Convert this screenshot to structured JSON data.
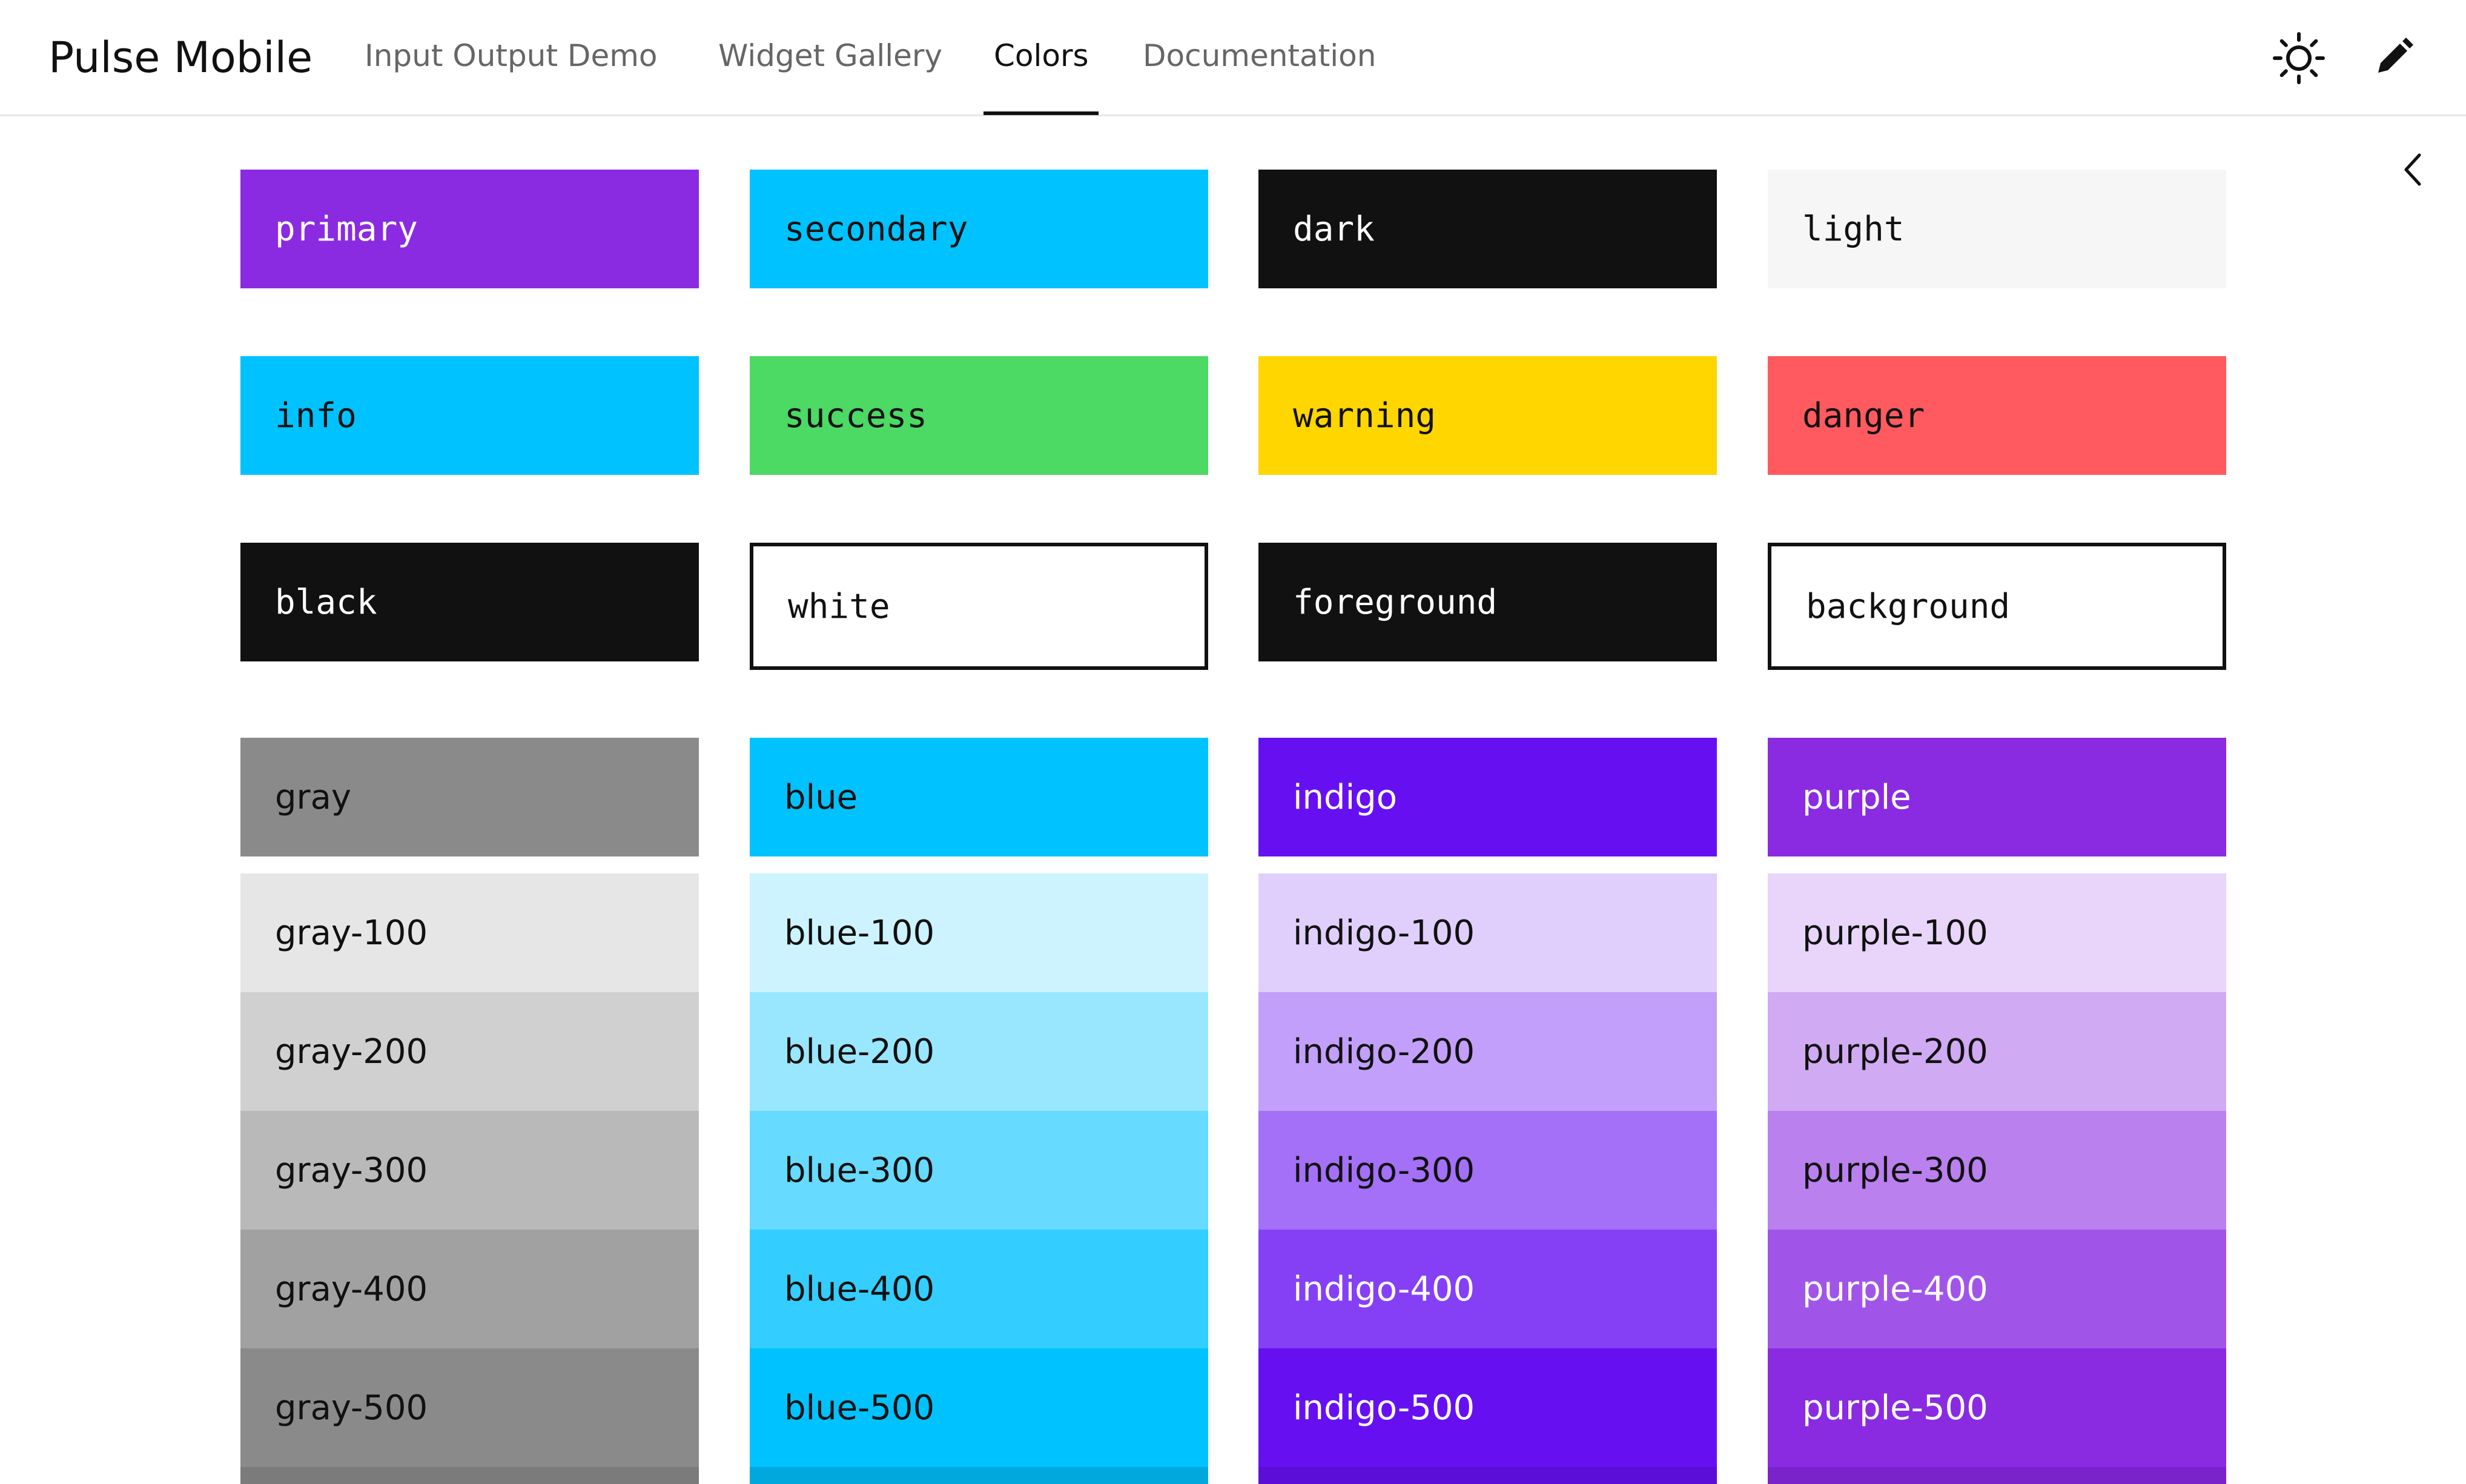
{
  "app": {
    "title": "Pulse Mobile"
  },
  "nav": {
    "items": [
      {
        "label": "Input Output Demo"
      },
      {
        "label": "Widget Gallery"
      },
      {
        "label": "Colors"
      },
      {
        "label": "Documentation"
      }
    ],
    "active_index": 2
  },
  "toolbar": {
    "icons": [
      "sun-icon",
      "pencil-icon"
    ],
    "collapse_icon": "chevron-left-icon"
  },
  "named_colors": [
    {
      "name": "primary",
      "bg": "#8A2BE2",
      "fg": "#FFFFFF"
    },
    {
      "name": "secondary",
      "bg": "#00C2FF",
      "fg": "#111111"
    },
    {
      "name": "dark",
      "bg": "#111111",
      "fg": "#FFFFFF"
    },
    {
      "name": "light",
      "bg": "#F6F6F6",
      "fg": "#111111"
    },
    {
      "name": "info",
      "bg": "#00C2FF",
      "fg": "#111111"
    },
    {
      "name": "success",
      "bg": "#4CD964",
      "fg": "#111111"
    },
    {
      "name": "warning",
      "bg": "#FFD600",
      "fg": "#111111"
    },
    {
      "name": "danger",
      "bg": "#FF5A5F",
      "fg": "#111111"
    },
    {
      "name": "black",
      "bg": "#111111",
      "fg": "#FFFFFF"
    },
    {
      "name": "white",
      "bg": "#FFFFFF",
      "fg": "#111111",
      "outlined": true
    },
    {
      "name": "foreground",
      "bg": "#111111",
      "fg": "#FFFFFF"
    },
    {
      "name": "background",
      "bg": "#FFFFFF",
      "fg": "#111111",
      "outlined": true
    }
  ],
  "palettes": [
    {
      "base": {
        "name": "gray",
        "bg": "#8A8A8A",
        "fg": "#111111"
      },
      "shades": [
        {
          "name": "gray-100",
          "bg": "#E6E6E6",
          "fg": "#111111"
        },
        {
          "name": "gray-200",
          "bg": "#D0D0D0",
          "fg": "#111111"
        },
        {
          "name": "gray-300",
          "bg": "#B9B9B9",
          "fg": "#111111"
        },
        {
          "name": "gray-400",
          "bg": "#A1A1A1",
          "fg": "#111111"
        },
        {
          "name": "gray-500",
          "bg": "#8A8A8A",
          "fg": "#111111"
        }
      ]
    },
    {
      "base": {
        "name": "blue",
        "bg": "#00C2FF",
        "fg": "#111111"
      },
      "shades": [
        {
          "name": "blue-100",
          "bg": "#CCF3FF",
          "fg": "#111111"
        },
        {
          "name": "blue-200",
          "bg": "#99E7FF",
          "fg": "#111111"
        },
        {
          "name": "blue-300",
          "bg": "#66DAFF",
          "fg": "#111111"
        },
        {
          "name": "blue-400",
          "bg": "#33CEFF",
          "fg": "#111111"
        },
        {
          "name": "blue-500",
          "bg": "#00C2FF",
          "fg": "#111111"
        }
      ]
    },
    {
      "base": {
        "name": "indigo",
        "bg": "#6610F2",
        "fg": "#FFFFFF"
      },
      "shades": [
        {
          "name": "indigo-100",
          "bg": "#E0CFFC",
          "fg": "#111111"
        },
        {
          "name": "indigo-200",
          "bg": "#C29FFA",
          "fg": "#111111"
        },
        {
          "name": "indigo-300",
          "bg": "#A370F7",
          "fg": "#111111"
        },
        {
          "name": "indigo-400",
          "bg": "#8540F5",
          "fg": "#FFFFFF"
        },
        {
          "name": "indigo-500",
          "bg": "#6610F2",
          "fg": "#FFFFFF"
        }
      ]
    },
    {
      "base": {
        "name": "purple",
        "bg": "#8A2BE2",
        "fg": "#FFFFFF"
      },
      "shades": [
        {
          "name": "purple-100",
          "bg": "#E8D5F9",
          "fg": "#111111"
        },
        {
          "name": "purple-200",
          "bg": "#D0AAF3",
          "fg": "#111111"
        },
        {
          "name": "purple-300",
          "bg": "#B980EE",
          "fg": "#111111"
        },
        {
          "name": "purple-400",
          "bg": "#A155E8",
          "fg": "#FFFFFF"
        },
        {
          "name": "purple-500",
          "bg": "#8A2BE2",
          "fg": "#FFFFFF"
        }
      ]
    }
  ],
  "next_shade_colors": [
    "#7B7B7B",
    "#00A8DD",
    "#5A0ED8",
    "#7A23CB"
  ]
}
